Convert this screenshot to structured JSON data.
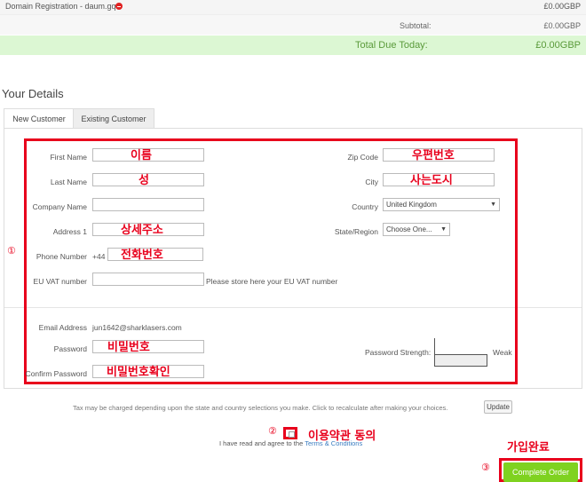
{
  "order": {
    "line_item_label": "Domain Registration - daum.gq",
    "line_item_price": "£0.00GBP",
    "subtotal_label": "Subtotal:",
    "subtotal_value": "£0.00GBP",
    "total_label": "Total Due Today:",
    "total_value": "£0.00GBP"
  },
  "section_title": "Your Details",
  "tabs": [
    {
      "label": "New Customer",
      "active": true
    },
    {
      "label": "Existing Customer",
      "active": false
    }
  ],
  "form": {
    "first_name_label": "First Name",
    "last_name_label": "Last Name",
    "company_label": "Company Name",
    "address_label": "Address 1",
    "phone_label": "Phone Number",
    "phone_prefix": "+44",
    "vat_label": "EU VAT number",
    "vat_hint": "Please store here your EU VAT number",
    "zip_label": "Zip Code",
    "city_label": "City",
    "country_label": "Country",
    "country_value": "United Kingdom",
    "state_label": "State/Region",
    "state_value": "Choose One...",
    "email_label": "Email Address",
    "email_value": "jun1642@sharklasers.com",
    "password_label": "Password",
    "confirm_label": "Confirm Password",
    "strength_label": "Password Strength:",
    "strength_value": "Weak"
  },
  "annotations": {
    "first_name": "이름",
    "last_name": "성",
    "address": "상세주소",
    "phone": "전화번호",
    "password": "비밀번호",
    "confirm": "비밀번호확인",
    "zip": "우편번호",
    "city": "사는도시",
    "terms": "이용약관 동의",
    "complete": "가입완료",
    "num1": "①",
    "num2": "②",
    "num3": "③"
  },
  "tax_note": "Tax may be charged depending upon the state and country selections you make. Click to recalculate after making your choices.",
  "update_button": "Update",
  "terms": {
    "prefix": "I have read and agree to the ",
    "link": "Terms & Conditions"
  },
  "complete_button": "Complete Order",
  "colors": {
    "total_bg": "#dcf7d3",
    "total_text": "#5a9a3a",
    "annotation_red": "#e8001c",
    "complete_green": "#7fd220",
    "link_blue": "#3a7cc0"
  }
}
